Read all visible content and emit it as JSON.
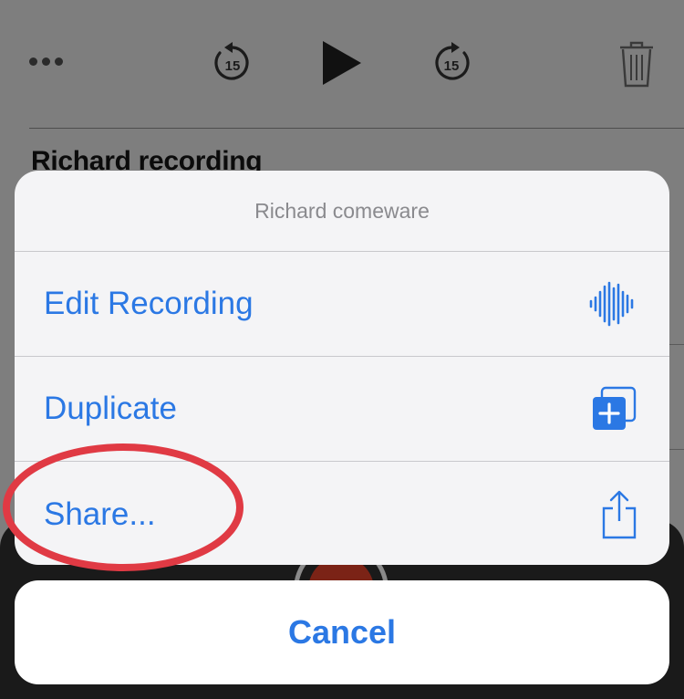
{
  "player": {
    "skip_back_seconds": "15",
    "skip_forward_seconds": "15",
    "recording_title": "Richard recording"
  },
  "action_sheet": {
    "title": "Richard comeware",
    "items": [
      {
        "label": "Edit Recording",
        "icon": "waveform-icon"
      },
      {
        "label": "Duplicate",
        "icon": "duplicate-icon"
      },
      {
        "label": "Share...",
        "icon": "share-icon"
      }
    ]
  },
  "cancel_label": "Cancel",
  "colors": {
    "accent": "#2b78e4",
    "annotation": "#e03a44",
    "overlay": "#7e7e7e"
  }
}
